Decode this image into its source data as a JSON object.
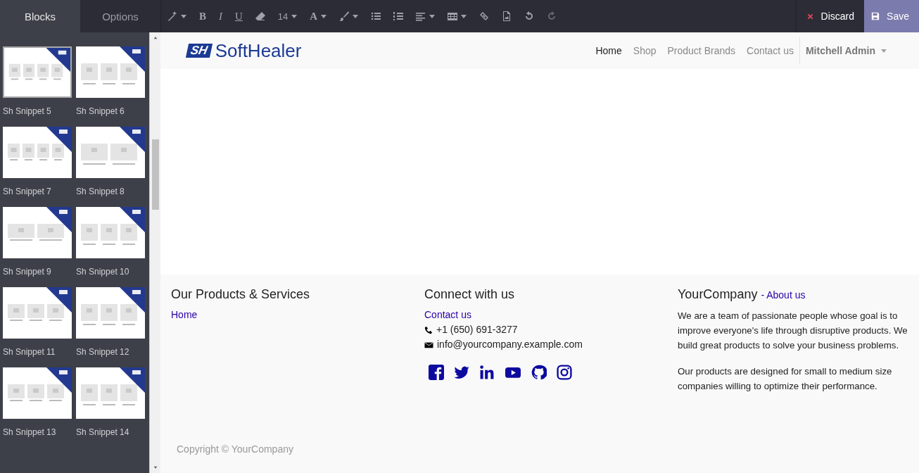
{
  "sidebar": {
    "tabs": [
      {
        "label": "Blocks",
        "selected": true
      },
      {
        "label": "Options",
        "selected": false
      }
    ],
    "snippets": [
      {
        "label": "Sh Snippet 5",
        "hovered": true
      },
      {
        "label": "Sh Snippet 6",
        "hovered": false
      },
      {
        "label": "Sh Snippet 7",
        "hovered": false
      },
      {
        "label": "Sh Snippet 8",
        "hovered": false
      },
      {
        "label": "Sh Snippet 9",
        "hovered": false
      },
      {
        "label": "Sh Snippet 10",
        "hovered": false
      },
      {
        "label": "Sh Snippet 11",
        "hovered": false
      },
      {
        "label": "Sh Snippet 12",
        "hovered": false
      },
      {
        "label": "Sh Snippet 13",
        "hovered": false
      },
      {
        "label": "Sh Snippet 14",
        "hovered": false
      }
    ]
  },
  "toolbar": {
    "bold": "B",
    "italic": "I",
    "underline": "U",
    "font_size": "14",
    "color_letter": "A",
    "redo_disabled": true,
    "discard": "Discard",
    "save": "Save"
  },
  "site": {
    "logo_mark": "SH",
    "logo_text": "SoftHealer",
    "nav": [
      {
        "label": "Home",
        "selected": true
      },
      {
        "label": "Shop",
        "selected": false
      },
      {
        "label": "Product Brands",
        "selected": false
      },
      {
        "label": "Contact us",
        "selected": false
      }
    ],
    "user_menu": "Mitchell Admin"
  },
  "footer": {
    "col1": {
      "title": "Our Products & Services",
      "links": [
        "Home"
      ]
    },
    "col2": {
      "title": "Connect with us",
      "link": "Contact us",
      "phone": "+1 (650) 691-3277",
      "email": "info@yourcompany.example.com"
    },
    "col3": {
      "title": "YourCompany",
      "title_link": "- About us",
      "paragraphs": [
        "We are a team of passionate people whose goal is to improve everyone's life through disruptive products. We build great products to solve your business problems.",
        "Our products are designed for small to medium size companies willing to optimize their performance."
      ]
    },
    "copyright": "Copyright © YourCompany"
  }
}
